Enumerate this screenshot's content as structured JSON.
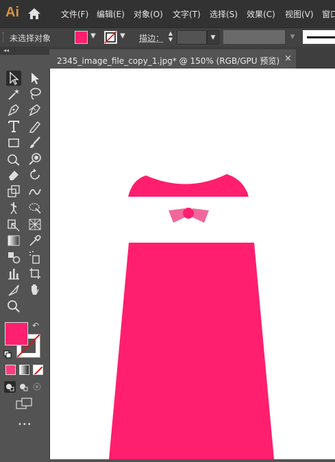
{
  "app": {
    "logo": "Ai"
  },
  "menu": [
    "文件(F)",
    "编辑(E)",
    "对象(O)",
    "文字(T)",
    "选择(S)",
    "效果(C)",
    "视图(V)",
    "窗口"
  ],
  "control_bar": {
    "selection_label": "未选择对象",
    "stroke_label": "描边：",
    "fill_color": "#ff1f6e"
  },
  "document_tab": {
    "title": "2345_image_file_copy_1.jpg* @ 150% (RGB/GPU 预览)",
    "close": "×"
  },
  "tools_panel": {
    "grip": "◂◂",
    "more": "•••",
    "fill_swatch_color": "#ff2170"
  },
  "artwork": {
    "color": "#ff1f6e",
    "bow_side_color": "#f0689a"
  }
}
